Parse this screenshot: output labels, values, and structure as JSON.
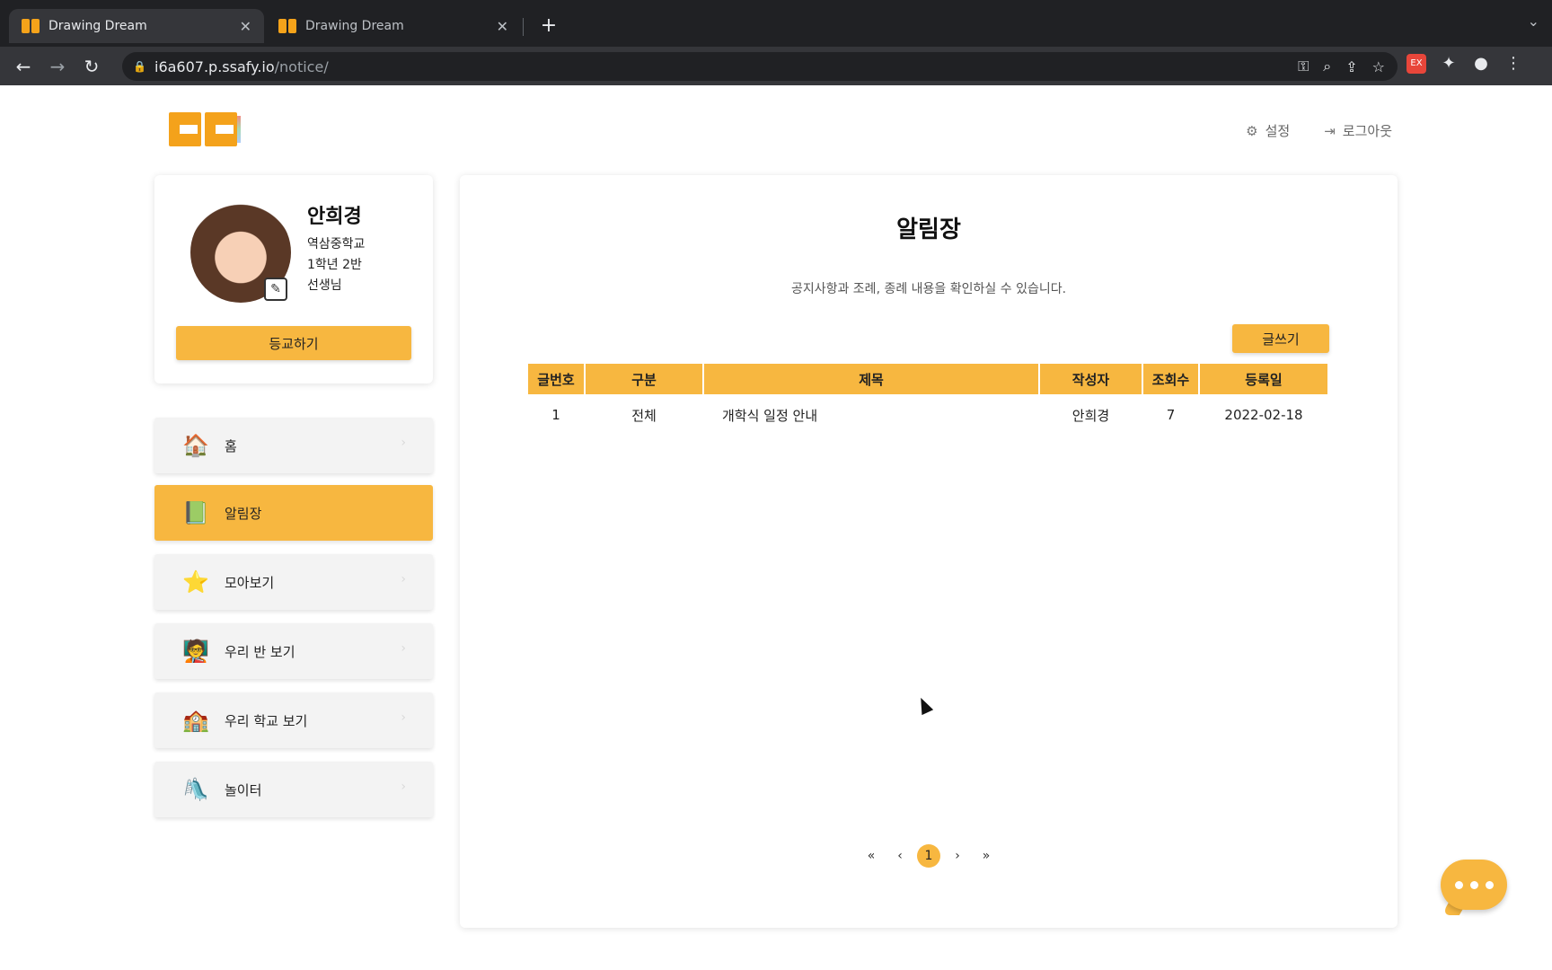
{
  "browser": {
    "tabs": [
      {
        "title": "Drawing Dream",
        "active": true
      },
      {
        "title": "Drawing Dream",
        "active": false
      }
    ],
    "close_glyph": "✕",
    "new_tab_glyph": "+",
    "url_host": "i6a607.p.ssafy.io",
    "url_path": "/notice/",
    "ext_badge": "EX"
  },
  "header": {
    "settings_label": "설정",
    "logout_label": "로그아웃"
  },
  "profile": {
    "name": "안희경",
    "school": "역삼중학교",
    "class": "1학년 2반",
    "role": "선생님",
    "checkin_label": "등교하기"
  },
  "sidebar": {
    "items": [
      {
        "label": "홈",
        "icon": "house-icon",
        "active": false
      },
      {
        "label": "알림장",
        "icon": "notebook-icon",
        "active": true
      },
      {
        "label": "모아보기",
        "icon": "star-icon",
        "active": false
      },
      {
        "label": "우리 반 보기",
        "icon": "teacher-icon",
        "active": false
      },
      {
        "label": "우리 학교 보기",
        "icon": "school-icon",
        "active": false
      },
      {
        "label": "놀이터",
        "icon": "slide-icon",
        "active": false
      }
    ]
  },
  "main": {
    "title": "알림장",
    "subtitle": "공지사항과 조례, 종례 내용을 확인하실 수 있습니다.",
    "write_label": "글쓰기",
    "columns": [
      "글번호",
      "구분",
      "제목",
      "작성자",
      "조회수",
      "등록일"
    ],
    "rows": [
      [
        "1",
        "전체",
        "개학식 일정 안내",
        "안희경",
        "7",
        "2022-02-18"
      ]
    ]
  },
  "pagination": {
    "first": "«",
    "prev": "‹",
    "current": "1",
    "next": "›",
    "last": "»"
  },
  "colors": {
    "accent": "#f7b740",
    "chrome_dark": "#202124",
    "chrome_toolbar": "#35363a"
  }
}
